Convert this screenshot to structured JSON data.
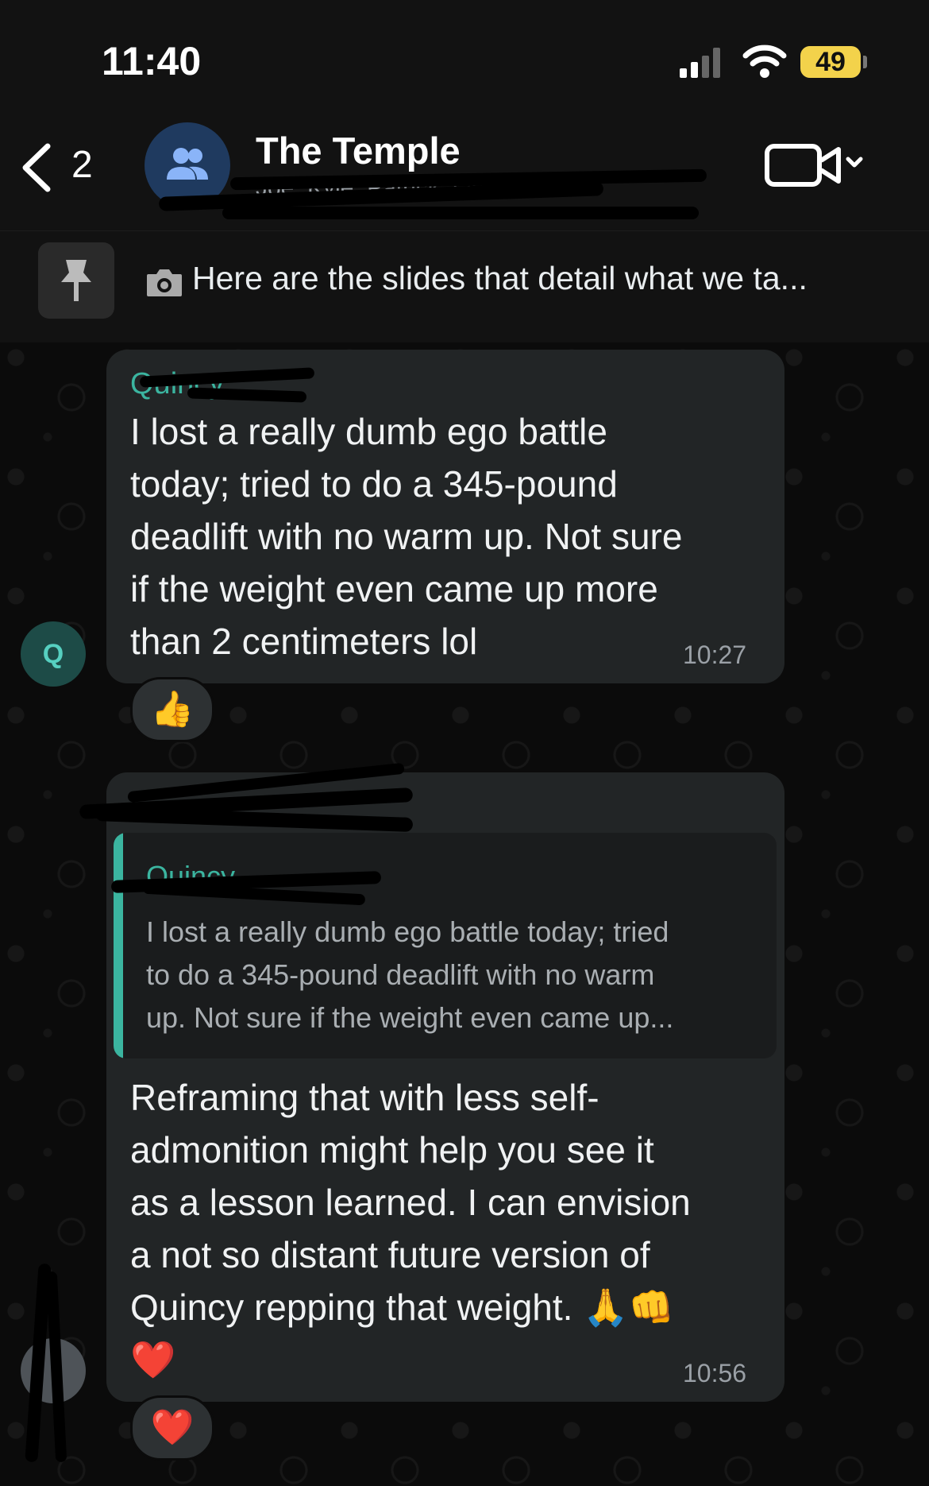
{
  "status_bar": {
    "time": "11:40",
    "battery": "49"
  },
  "header": {
    "back_count": "2",
    "title": "The Temple",
    "subtitle": "Joe, Kyle, Patrick, Qui..."
  },
  "pinned": {
    "text": "Here are the slides that detail what we ta..."
  },
  "messages": [
    {
      "sender": "Quincy",
      "avatar_initial": "Q",
      "lines": [
        "I lost a really dumb ego battle",
        "today; tried to do a 345-pound",
        "deadlift with no warm up. Not sure",
        "if the weight even came up more",
        "than 2 centimeters lol"
      ],
      "time": "10:27",
      "reaction": "👍"
    },
    {
      "sender": "",
      "quote": {
        "sender": "Quincy",
        "lines": [
          "I lost a really dumb ego battle today; tried",
          "to do a 345-pound deadlift with no warm",
          "up. Not sure if the weight even came up..."
        ]
      },
      "lines": [
        "Reframing that with less self-",
        "admonition might help you see it",
        "as a lesson learned.  I can envision",
        "a not so distant future version of",
        "Quincy repping that weight. 🙏👊",
        "❤️"
      ],
      "time": "10:56",
      "reaction": "❤️"
    }
  ],
  "colors": {
    "accent": "#3bb5a0",
    "bubble": "#222526",
    "background": "#0b0b0b"
  }
}
